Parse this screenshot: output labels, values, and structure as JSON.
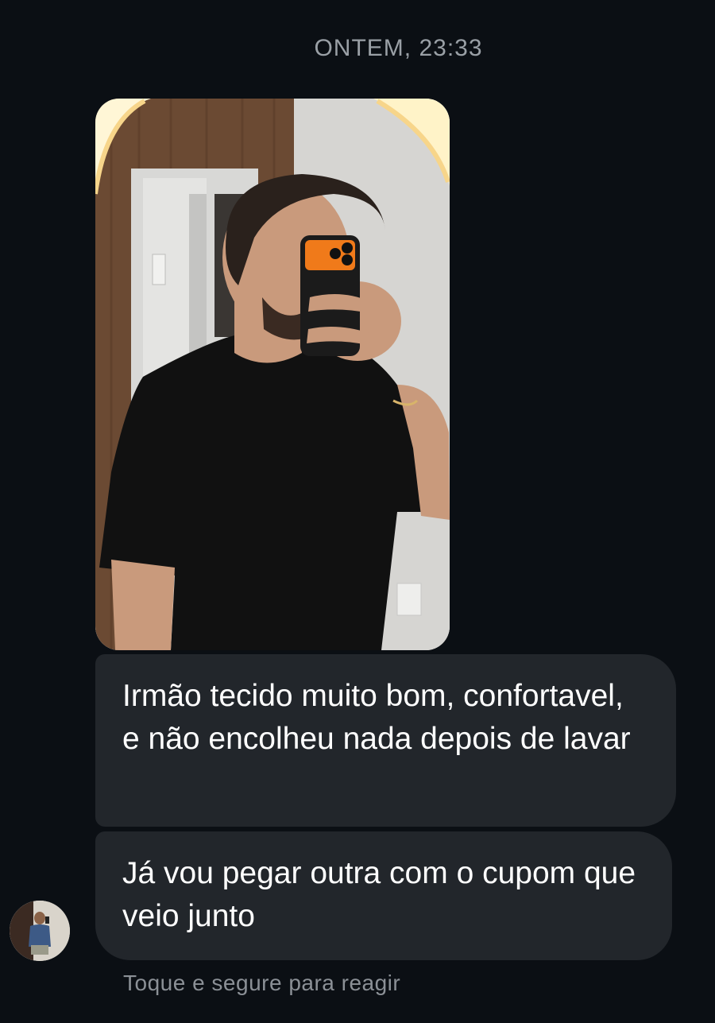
{
  "conversation": {
    "timestamp": "ONTEM, 23:33",
    "messages": [
      {
        "type": "image",
        "description_icon": "mirror-selfie-photo"
      },
      {
        "type": "text",
        "text": "Irmão tecido muito bom, confortavel, e não encolheu nada depois de lavar"
      },
      {
        "type": "text",
        "text": "Já vou pegar outra com o cupom que veio junto"
      }
    ],
    "reaction_hint": "Toque e segure para reagir"
  },
  "colors": {
    "background": "#0b0f14",
    "bubble": "#22262b",
    "timestamp_text": "#9aa0a6",
    "hint_text": "#8b9096",
    "phone_case_accent": "#f07a1a"
  }
}
